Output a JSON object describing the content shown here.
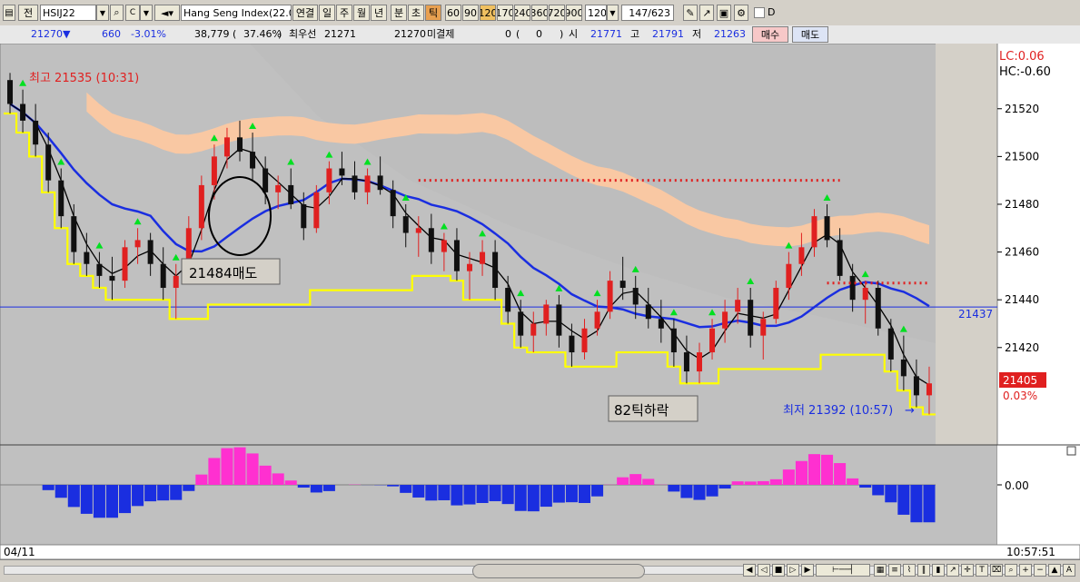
{
  "toolbar": {
    "mode_label": "전",
    "symbol": "HSIJ22",
    "index_name": "Hang Seng Index(22.0",
    "period_buttons": [
      "연결",
      "일",
      "주",
      "월",
      "년",
      "분",
      "초",
      "틱"
    ],
    "tick_values": [
      "60",
      "90",
      "120",
      "170",
      "240",
      "360",
      "720",
      "900"
    ],
    "selected_tick_value": "120",
    "tick_select": "120",
    "counter": "147/623",
    "checkbox_label": "D"
  },
  "status": {
    "price": "21270▼",
    "change": "660",
    "change_pct": "-3.01%",
    "volume": "38,779",
    "volume_pct_open": "(",
    "volume_pct": "37.46%",
    "volume_pct_close": ")",
    "best_ask_label": "최우선",
    "best_ask": "21271",
    "best_bid": "21270",
    "unfilled_label": "미결제",
    "unfilled": "0",
    "unfilled_diff_open": "(",
    "unfilled_diff": "0",
    "unfilled_diff_close": ")",
    "open_label": "시",
    "open": "21771",
    "high_label": "고",
    "high": "21791",
    "low_label": "저",
    "low": "21263",
    "buy_label": "매수",
    "sell_label": "매도"
  },
  "colors": {
    "up": "#e02020",
    "down": "#101010",
    "ma_fast": "#000000",
    "ma_slow": "#1a2ee0",
    "envelope_low": "#ffff00",
    "band": "#ffc9a0",
    "buy_signal": "#00e020",
    "sell_marker": "#e02020",
    "osc_pos": "#ff30d0",
    "osc_neg": "#1a2ee0"
  },
  "chart_data": {
    "type": "candlestick",
    "ylim": [
      21380,
      21545
    ],
    "y_ticks": [
      21420,
      21440,
      21460,
      21480,
      21500,
      21520
    ],
    "top_left_labels": [
      "LC:0.06",
      "HC:-0.60"
    ],
    "max_label": "최고 21535 (10:31)",
    "min_label": "최저 21392 (10:57)",
    "min_arrow": "→",
    "hline_value": 21437,
    "hline_label": "21437",
    "last_price": "21405",
    "last_pct": "0.03%",
    "annotations": [
      {
        "text": "21484매도"
      },
      {
        "text": "82틱하락"
      }
    ],
    "x_label": "04/11",
    "time_label": "10:57:51",
    "oscillator": {
      "zero_label": "0.00",
      "ylim": [
        -1.0,
        1.0
      ]
    },
    "candles": [
      [
        21532,
        21535,
        21518,
        21522
      ],
      [
        21522,
        21528,
        21510,
        21515
      ],
      [
        21515,
        21522,
        21500,
        21505
      ],
      [
        21505,
        21510,
        21485,
        21490
      ],
      [
        21490,
        21495,
        21470,
        21475
      ],
      [
        21475,
        21480,
        21455,
        21460
      ],
      [
        21460,
        21468,
        21450,
        21455
      ],
      [
        21455,
        21460,
        21445,
        21450
      ],
      [
        21450,
        21458,
        21440,
        21448
      ],
      [
        21448,
        21465,
        21445,
        21462
      ],
      [
        21462,
        21470,
        21455,
        21465
      ],
      [
        21465,
        21468,
        21450,
        21455
      ],
      [
        21455,
        21462,
        21440,
        21445
      ],
      [
        21445,
        21455,
        21432,
        21450
      ],
      [
        21450,
        21475,
        21448,
        21470
      ],
      [
        21470,
        21492,
        21465,
        21488
      ],
      [
        21488,
        21505,
        21482,
        21500
      ],
      [
        21500,
        21512,
        21495,
        21508
      ],
      [
        21508,
        21515,
        21498,
        21502
      ],
      [
        21502,
        21510,
        21490,
        21495
      ],
      [
        21495,
        21500,
        21480,
        21485
      ],
      [
        21485,
        21492,
        21478,
        21488
      ],
      [
        21488,
        21495,
        21478,
        21480
      ],
      [
        21480,
        21485,
        21465,
        21470
      ],
      [
        21470,
        21488,
        21468,
        21485
      ],
      [
        21485,
        21498,
        21480,
        21495
      ],
      [
        21495,
        21502,
        21488,
        21492
      ],
      [
        21492,
        21498,
        21482,
        21485
      ],
      [
        21485,
        21495,
        21480,
        21492
      ],
      [
        21492,
        21500,
        21484,
        21486
      ],
      [
        21486,
        21490,
        21470,
        21475
      ],
      [
        21475,
        21480,
        21462,
        21468
      ],
      [
        21468,
        21475,
        21458,
        21470
      ],
      [
        21470,
        21476,
        21455,
        21460
      ],
      [
        21460,
        21468,
        21452,
        21465
      ],
      [
        21465,
        21470,
        21448,
        21452
      ],
      [
        21452,
        21460,
        21440,
        21455
      ],
      [
        21455,
        21465,
        21450,
        21460
      ],
      [
        21460,
        21465,
        21440,
        21445
      ],
      [
        21445,
        21450,
        21430,
        21435
      ],
      [
        21435,
        21440,
        21420,
        21425
      ],
      [
        21425,
        21435,
        21418,
        21430
      ],
      [
        21430,
        21440,
        21425,
        21438
      ],
      [
        21438,
        21442,
        21420,
        21425
      ],
      [
        21425,
        21430,
        21412,
        21418
      ],
      [
        21418,
        21432,
        21415,
        21428
      ],
      [
        21428,
        21440,
        21425,
        21435
      ],
      [
        21435,
        21452,
        21432,
        21448
      ],
      [
        21448,
        21458,
        21440,
        21445
      ],
      [
        21445,
        21450,
        21432,
        21438
      ],
      [
        21438,
        21445,
        21428,
        21432
      ],
      [
        21432,
        21440,
        21422,
        21428
      ],
      [
        21428,
        21432,
        21412,
        21418
      ],
      [
        21418,
        21425,
        21405,
        21410
      ],
      [
        21410,
        21422,
        21405,
        21418
      ],
      [
        21418,
        21432,
        21415,
        21428
      ],
      [
        21428,
        21440,
        21422,
        21435
      ],
      [
        21435,
        21445,
        21430,
        21440
      ],
      [
        21440,
        21445,
        21420,
        21425
      ],
      [
        21425,
        21435,
        21415,
        21432
      ],
      [
        21432,
        21448,
        21430,
        21445
      ],
      [
        21445,
        21460,
        21440,
        21455
      ],
      [
        21455,
        21468,
        21450,
        21462
      ],
      [
        21462,
        21478,
        21458,
        21475
      ],
      [
        21475,
        21480,
        21462,
        21465
      ],
      [
        21465,
        21470,
        21448,
        21450
      ],
      [
        21450,
        21455,
        21435,
        21440
      ],
      [
        21440,
        21448,
        21430,
        21445
      ],
      [
        21445,
        21448,
        21425,
        21428
      ],
      [
        21428,
        21432,
        21410,
        21415
      ],
      [
        21415,
        21425,
        21402,
        21408
      ],
      [
        21408,
        21415,
        21395,
        21400
      ],
      [
        21400,
        21412,
        21392,
        21405
      ]
    ]
  }
}
